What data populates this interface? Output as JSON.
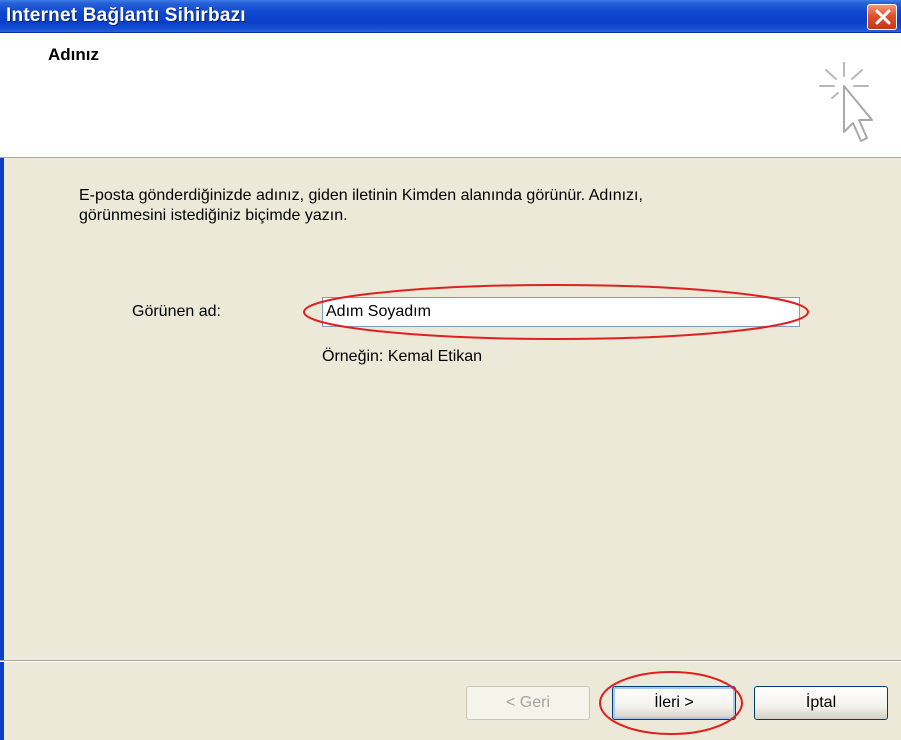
{
  "window": {
    "title": "Internet Bağlantı Sihirbazı"
  },
  "header": {
    "title": "Adınız"
  },
  "body": {
    "description_line1": "E-posta gönderdiğinizde adınız, giden iletinin Kimden alanında görünür. Adınızı,",
    "description_line2": "görünmesini istediğiniz biçimde yazın.",
    "display_name_label": "Görünen ad:",
    "display_name_value": "Adım Soyadım",
    "example_text": "Örneğin: Kemal Etikan"
  },
  "buttons": {
    "back_label": "< Geri",
    "next_label": "İleri >",
    "cancel_label": "İptal"
  },
  "colors": {
    "title_bar": "#0A3FC6",
    "dialog_bg": "#ECE9D8",
    "annotation": "#E02020"
  },
  "icons": {
    "close": "close-icon",
    "wizard": "wizard-cursor-icon"
  }
}
